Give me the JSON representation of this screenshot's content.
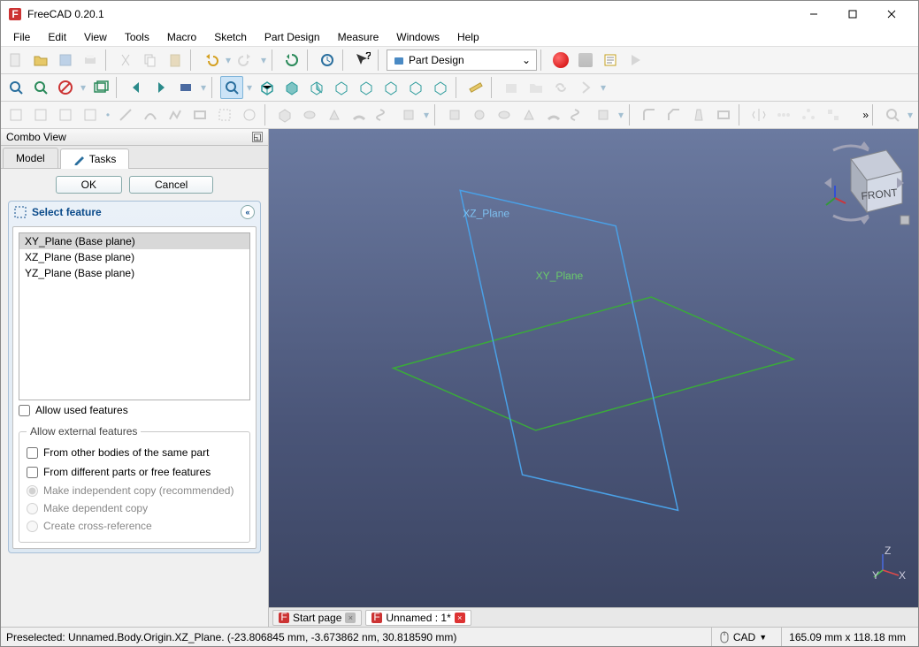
{
  "window": {
    "title": "FreeCAD 0.20.1"
  },
  "menu": [
    "File",
    "Edit",
    "View",
    "Tools",
    "Macro",
    "Sketch",
    "Part Design",
    "Measure",
    "Windows",
    "Help"
  ],
  "workbench": {
    "selected": "Part Design"
  },
  "combo": {
    "title": "Combo View",
    "tabs": {
      "model": "Model",
      "tasks": "Tasks",
      "active": "tasks"
    },
    "buttons": {
      "ok": "OK",
      "cancel": "Cancel"
    },
    "panel_title": "Select feature",
    "features": [
      {
        "label": "XY_Plane (Base plane)",
        "selected": true
      },
      {
        "label": "XZ_Plane (Base plane)",
        "selected": false
      },
      {
        "label": "YZ_Plane (Base plane)",
        "selected": false
      }
    ],
    "allow_used": "Allow used features",
    "external_legend": "Allow external features",
    "ext_other_bodies": "From other bodies of the same part",
    "ext_diff_parts": "From different parts or free features",
    "radio_independent": "Make independent copy (recommended)",
    "radio_dependent": "Make dependent copy",
    "radio_crossref": "Create cross-reference"
  },
  "viewport": {
    "labels": {
      "xz": "XZ_Plane",
      "xy": "XY_Plane"
    },
    "navcube_face": "FRONT"
  },
  "doc_tabs": [
    {
      "label": "Start page",
      "active": false,
      "close_style": "gray"
    },
    {
      "label": "Unnamed : 1*",
      "active": true,
      "close_style": "red"
    }
  ],
  "status": {
    "message": "Preselected: Unnamed.Body.Origin.XZ_Plane. (-23.806845 mm, -3.673862 nm, 30.818590 mm)",
    "nav_mode": "CAD",
    "dims": "165.09 mm x 118.18 mm"
  },
  "axes": {
    "x": "X",
    "y": "Y",
    "z": "Z"
  }
}
